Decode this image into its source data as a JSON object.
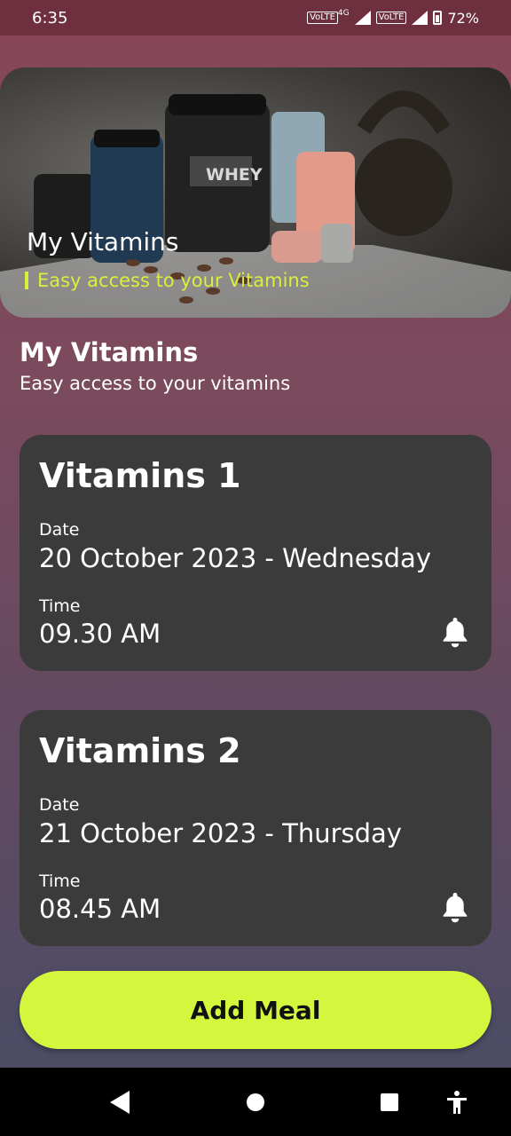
{
  "status_bar": {
    "time": "6:35",
    "sim1_label": "VoLTE",
    "sim1_net": "4G",
    "sim2_label": "VoLTE",
    "battery": "72%"
  },
  "hero": {
    "title": "My Vitamins",
    "subtitle": "Easy access to your Vitamins",
    "image_label": "WHEY"
  },
  "header": {
    "title": "My Vitamins",
    "subtitle": "Easy access to your vitamins"
  },
  "cards": [
    {
      "title": "Vitamins 1",
      "date_label": "Date",
      "date": "20 October 2023 - Wednesday",
      "time_label": "Time",
      "time": "09.30 AM",
      "icon": "bell-icon"
    },
    {
      "title": "Vitamins 2",
      "date_label": "Date",
      "date": "21 October 2023 - Thursday",
      "time_label": "Time",
      "time": "08.45 AM",
      "icon": "bell-icon"
    }
  ],
  "add_button": {
    "label": "Add Meal"
  },
  "colors": {
    "accent": "#d4f63d",
    "hero_subtitle": "#d9ef3e",
    "card_bg": "#3b3b3c",
    "status_bar": "#6e2f3f"
  }
}
